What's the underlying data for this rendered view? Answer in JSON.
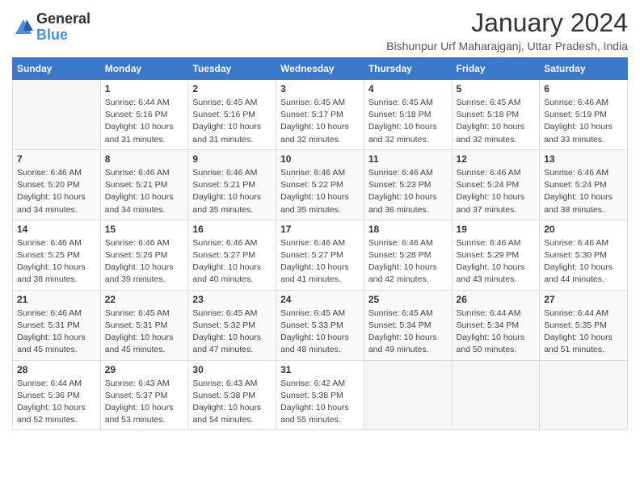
{
  "logo": {
    "text_general": "General",
    "text_blue": "Blue"
  },
  "title": "January 2024",
  "subtitle": "Bishunpur Urf Maharajganj, Uttar Pradesh, India",
  "days_of_week": [
    "Sunday",
    "Monday",
    "Tuesday",
    "Wednesday",
    "Thursday",
    "Friday",
    "Saturday"
  ],
  "weeks": [
    [
      {
        "num": "",
        "info": ""
      },
      {
        "num": "1",
        "info": "Sunrise: 6:44 AM\nSunset: 5:16 PM\nDaylight: 10 hours\nand 31 minutes."
      },
      {
        "num": "2",
        "info": "Sunrise: 6:45 AM\nSunset: 5:16 PM\nDaylight: 10 hours\nand 31 minutes."
      },
      {
        "num": "3",
        "info": "Sunrise: 6:45 AM\nSunset: 5:17 PM\nDaylight: 10 hours\nand 32 minutes."
      },
      {
        "num": "4",
        "info": "Sunrise: 6:45 AM\nSunset: 5:18 PM\nDaylight: 10 hours\nand 32 minutes."
      },
      {
        "num": "5",
        "info": "Sunrise: 6:45 AM\nSunset: 5:18 PM\nDaylight: 10 hours\nand 32 minutes."
      },
      {
        "num": "6",
        "info": "Sunrise: 6:46 AM\nSunset: 5:19 PM\nDaylight: 10 hours\nand 33 minutes."
      }
    ],
    [
      {
        "num": "7",
        "info": "Sunrise: 6:46 AM\nSunset: 5:20 PM\nDaylight: 10 hours\nand 34 minutes."
      },
      {
        "num": "8",
        "info": "Sunrise: 6:46 AM\nSunset: 5:21 PM\nDaylight: 10 hours\nand 34 minutes."
      },
      {
        "num": "9",
        "info": "Sunrise: 6:46 AM\nSunset: 5:21 PM\nDaylight: 10 hours\nand 35 minutes."
      },
      {
        "num": "10",
        "info": "Sunrise: 6:46 AM\nSunset: 5:22 PM\nDaylight: 10 hours\nand 35 minutes."
      },
      {
        "num": "11",
        "info": "Sunrise: 6:46 AM\nSunset: 5:23 PM\nDaylight: 10 hours\nand 36 minutes."
      },
      {
        "num": "12",
        "info": "Sunrise: 6:46 AM\nSunset: 5:24 PM\nDaylight: 10 hours\nand 37 minutes."
      },
      {
        "num": "13",
        "info": "Sunrise: 6:46 AM\nSunset: 5:24 PM\nDaylight: 10 hours\nand 38 minutes."
      }
    ],
    [
      {
        "num": "14",
        "info": "Sunrise: 6:46 AM\nSunset: 5:25 PM\nDaylight: 10 hours\nand 38 minutes."
      },
      {
        "num": "15",
        "info": "Sunrise: 6:46 AM\nSunset: 5:26 PM\nDaylight: 10 hours\nand 39 minutes."
      },
      {
        "num": "16",
        "info": "Sunrise: 6:46 AM\nSunset: 5:27 PM\nDaylight: 10 hours\nand 40 minutes."
      },
      {
        "num": "17",
        "info": "Sunrise: 6:46 AM\nSunset: 5:27 PM\nDaylight: 10 hours\nand 41 minutes."
      },
      {
        "num": "18",
        "info": "Sunrise: 6:46 AM\nSunset: 5:28 PM\nDaylight: 10 hours\nand 42 minutes."
      },
      {
        "num": "19",
        "info": "Sunrise: 6:46 AM\nSunset: 5:29 PM\nDaylight: 10 hours\nand 43 minutes."
      },
      {
        "num": "20",
        "info": "Sunrise: 6:46 AM\nSunset: 5:30 PM\nDaylight: 10 hours\nand 44 minutes."
      }
    ],
    [
      {
        "num": "21",
        "info": "Sunrise: 6:46 AM\nSunset: 5:31 PM\nDaylight: 10 hours\nand 45 minutes."
      },
      {
        "num": "22",
        "info": "Sunrise: 6:45 AM\nSunset: 5:31 PM\nDaylight: 10 hours\nand 45 minutes."
      },
      {
        "num": "23",
        "info": "Sunrise: 6:45 AM\nSunset: 5:32 PM\nDaylight: 10 hours\nand 47 minutes."
      },
      {
        "num": "24",
        "info": "Sunrise: 6:45 AM\nSunset: 5:33 PM\nDaylight: 10 hours\nand 48 minutes."
      },
      {
        "num": "25",
        "info": "Sunrise: 6:45 AM\nSunset: 5:34 PM\nDaylight: 10 hours\nand 49 minutes."
      },
      {
        "num": "26",
        "info": "Sunrise: 6:44 AM\nSunset: 5:34 PM\nDaylight: 10 hours\nand 50 minutes."
      },
      {
        "num": "27",
        "info": "Sunrise: 6:44 AM\nSunset: 5:35 PM\nDaylight: 10 hours\nand 51 minutes."
      }
    ],
    [
      {
        "num": "28",
        "info": "Sunrise: 6:44 AM\nSunset: 5:36 PM\nDaylight: 10 hours\nand 52 minutes."
      },
      {
        "num": "29",
        "info": "Sunrise: 6:43 AM\nSunset: 5:37 PM\nDaylight: 10 hours\nand 53 minutes."
      },
      {
        "num": "30",
        "info": "Sunrise: 6:43 AM\nSunset: 5:38 PM\nDaylight: 10 hours\nand 54 minutes."
      },
      {
        "num": "31",
        "info": "Sunrise: 6:42 AM\nSunset: 5:38 PM\nDaylight: 10 hours\nand 55 minutes."
      },
      {
        "num": "",
        "info": ""
      },
      {
        "num": "",
        "info": ""
      },
      {
        "num": "",
        "info": ""
      }
    ]
  ]
}
